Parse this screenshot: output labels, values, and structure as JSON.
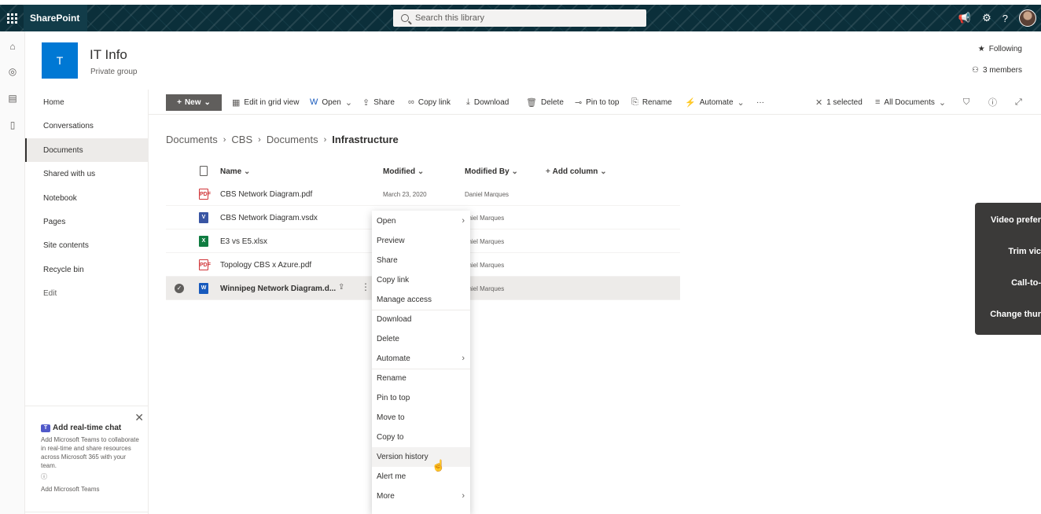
{
  "suite": {
    "app_name": "SharePoint",
    "search_placeholder": "Search this library"
  },
  "site": {
    "logo_letter": "T",
    "title": "IT Info",
    "subtitle": "Private group",
    "following_label": "Following",
    "members_label": "3 members"
  },
  "leftnav": {
    "items": [
      {
        "label": "Home"
      },
      {
        "label": "Conversations"
      },
      {
        "label": "Documents"
      },
      {
        "label": "Shared with us"
      },
      {
        "label": "Notebook"
      },
      {
        "label": "Pages"
      },
      {
        "label": "Site contents"
      },
      {
        "label": "Recycle bin"
      },
      {
        "label": "Edit"
      }
    ],
    "promo": {
      "title": "Add real-time chat",
      "body": "Add Microsoft Teams to collaborate in real-time and share resources across Microsoft 365 with your team.",
      "link": "Add Microsoft Teams"
    }
  },
  "commandbar": {
    "new": "New",
    "edit_grid": "Edit in grid view",
    "open": "Open",
    "share": "Share",
    "copy_link": "Copy link",
    "download": "Download",
    "delete": "Delete",
    "pin_to_top": "Pin to top",
    "rename": "Rename",
    "automate": "Automate",
    "more": "···",
    "selected": "1 selected",
    "view": "All Documents"
  },
  "breadcrumb": {
    "items": [
      "Documents",
      "CBS",
      "Documents"
    ],
    "current": "Infrastructure"
  },
  "list": {
    "columns": {
      "name": "Name",
      "modified": "Modified",
      "modified_by": "Modified By",
      "add_column": "Add column"
    },
    "rows": [
      {
        "name": "CBS Network Diagram.pdf",
        "modified": "March 23, 2020",
        "modified_by": "Daniel Marques",
        "type": "pdf"
      },
      {
        "name": "CBS Network Diagram.vsdx",
        "modified": "",
        "modified_by": "aniel Marques",
        "type": "vsdx"
      },
      {
        "name": "E3 vs E5.xlsx",
        "modified": "",
        "modified_by": "aniel Marques",
        "type": "xlsx"
      },
      {
        "name": "Topology CBS x Azure.pdf",
        "modified": "",
        "modified_by": "aniel Marques",
        "type": "pdf"
      },
      {
        "name": "Winnipeg Network Diagram.d...",
        "modified": "",
        "modified_by": "aniel Marques",
        "type": "docx"
      }
    ]
  },
  "context_menu": {
    "items": [
      {
        "label": "Open",
        "submenu": true
      },
      {
        "label": "Preview"
      },
      {
        "label": "Share"
      },
      {
        "label": "Copy link"
      },
      {
        "label": "Manage access"
      },
      {
        "label": "Download"
      },
      {
        "label": "Delete"
      },
      {
        "label": "Automate",
        "submenu": true
      },
      {
        "label": "Rename"
      },
      {
        "label": "Pin to top"
      },
      {
        "label": "Move to"
      },
      {
        "label": "Copy to"
      },
      {
        "label": "Version history"
      },
      {
        "label": "Alert me"
      },
      {
        "label": "More",
        "submenu": true
      }
    ]
  },
  "video_panel": {
    "items": [
      "Video prefer",
      "Trim vic",
      "Call-to-",
      "Change thur"
    ]
  },
  "colors": {
    "suite_bar": "#0b2f3a",
    "site_logo": "#0078d4",
    "new_button": "#605e5c"
  }
}
